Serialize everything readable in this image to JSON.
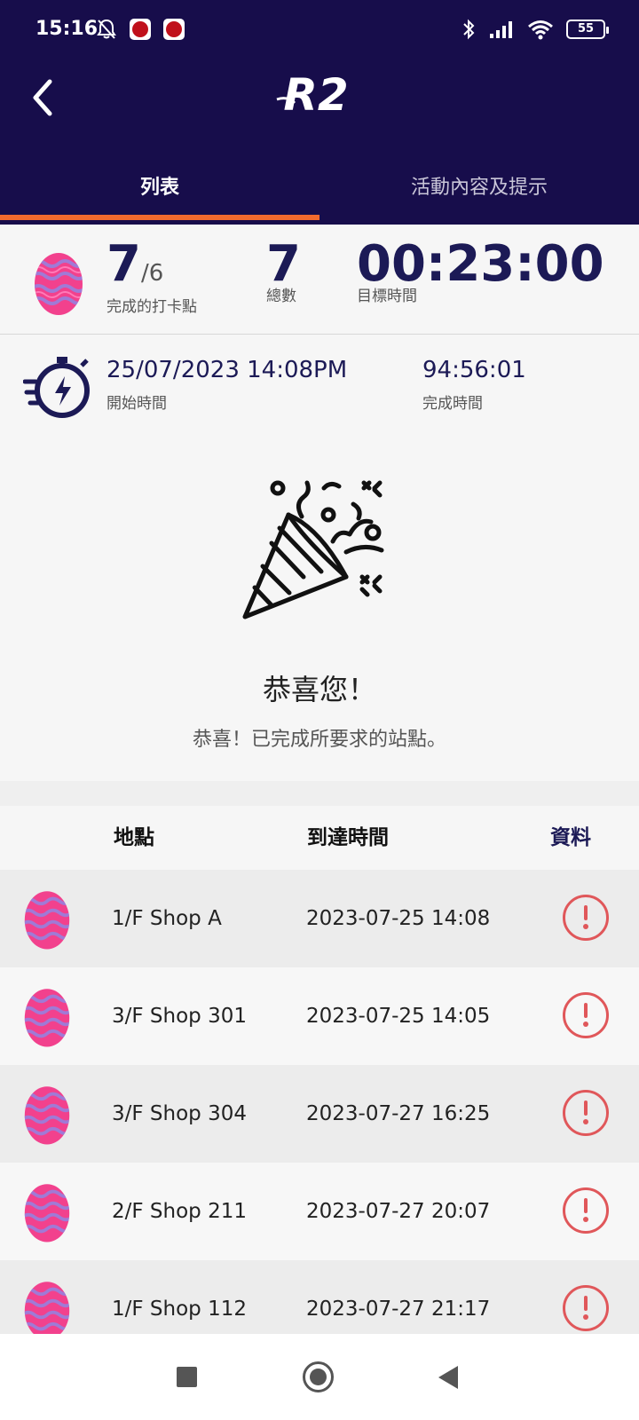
{
  "status_bar": {
    "time": "15:16",
    "battery": "55",
    "icons": [
      "bell-off-icon",
      "app-notification-icon",
      "app-notification-icon",
      "bluetooth-icon",
      "signal-icon",
      "wifi-icon",
      "battery-icon"
    ]
  },
  "header": {
    "back_icon": "chevron-left-icon",
    "logo_text": "R2",
    "background_color": "#170d4b"
  },
  "tabs": [
    {
      "label": "列表",
      "active": true
    },
    {
      "label": "活動內容及提示",
      "active": false
    }
  ],
  "summary": {
    "completed": "7",
    "completed_of": "/6",
    "completed_label": "完成的打卡點",
    "total": "7",
    "total_label": "總數",
    "target_time": "00:23:00",
    "target_time_label": "目標時間"
  },
  "timer": {
    "start_value": "25/07/2023 14:08PM",
    "start_label": "開始時間",
    "finish_value": "94:56:01",
    "finish_label": "完成時間"
  },
  "congrats": {
    "title": "恭喜您！",
    "message": "恭喜！已完成所要求的站點。"
  },
  "table": {
    "headers": {
      "location": "地點",
      "arrival": "到達時間",
      "info": "資料"
    },
    "rows": [
      {
        "location": "1/F Shop A",
        "arrival": "2023-07-25 14:08"
      },
      {
        "location": "3/F Shop 301",
        "arrival": "2023-07-25 14:05"
      },
      {
        "location": "3/F Shop 304",
        "arrival": "2023-07-27 16:25"
      },
      {
        "location": "2/F Shop 211",
        "arrival": "2023-07-27 20:07"
      },
      {
        "location": "1/F Shop 112",
        "arrival": "2023-07-27 21:17"
      }
    ]
  },
  "colors": {
    "accent": "#f26a2e",
    "navy": "#1c1a56",
    "alert": "#e0575a",
    "egg_pink": "#f2418d",
    "egg_wave": "#a07ad6"
  }
}
